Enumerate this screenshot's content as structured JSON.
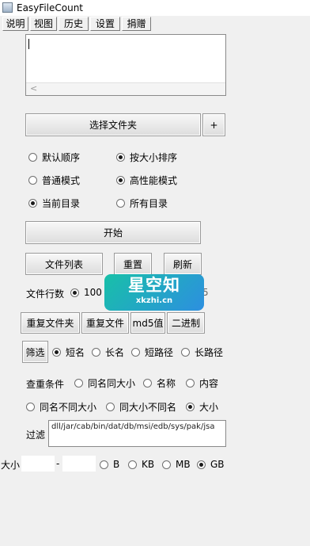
{
  "window": {
    "title": "EasyFileCount"
  },
  "menu": [
    "说明",
    "视图",
    "历史",
    "设置",
    "捐赠"
  ],
  "buttons": {
    "select_folder": "选择文件夹",
    "add": "+",
    "start": "开始",
    "file_list": "文件列表",
    "reset": "重置",
    "refresh": "刷新",
    "dup_folder": "重复文件夹",
    "dup_file": "重复文件",
    "md5": "md5值",
    "binary": "二进制",
    "filter": "筛选"
  },
  "order": {
    "default": "默认顺序",
    "by_size": "按大小排序"
  },
  "mode": {
    "normal": "普通模式",
    "performance": "高性能模式"
  },
  "scope": {
    "current": "当前目录",
    "all": "所有目录"
  },
  "lines": {
    "label": "文件行数",
    "value": "100",
    "trailing": "5"
  },
  "name_filter": {
    "short_name": "短名",
    "long_name": "长名",
    "short_path": "短路径",
    "long_path": "长路径"
  },
  "dup_conditions": {
    "label": "查重条件",
    "same_name_size": "同名同大小",
    "name": "名称",
    "content": "内容",
    "same_name_diff_size": "同名不同大小",
    "same_size_diff_name": "同大小不同名",
    "size": "大小"
  },
  "exclude": {
    "label": "过滤",
    "value": "dll/jar/cab/bin/dat/db/msi/edb/sys/pak/jsa"
  },
  "size_range": {
    "label": "大小",
    "separator": "-",
    "units": [
      "B",
      "KB",
      "MB",
      "GB"
    ],
    "selected_unit": "GB"
  },
  "watermark": {
    "title": "星空知",
    "domain": "xkzhi.cn"
  }
}
